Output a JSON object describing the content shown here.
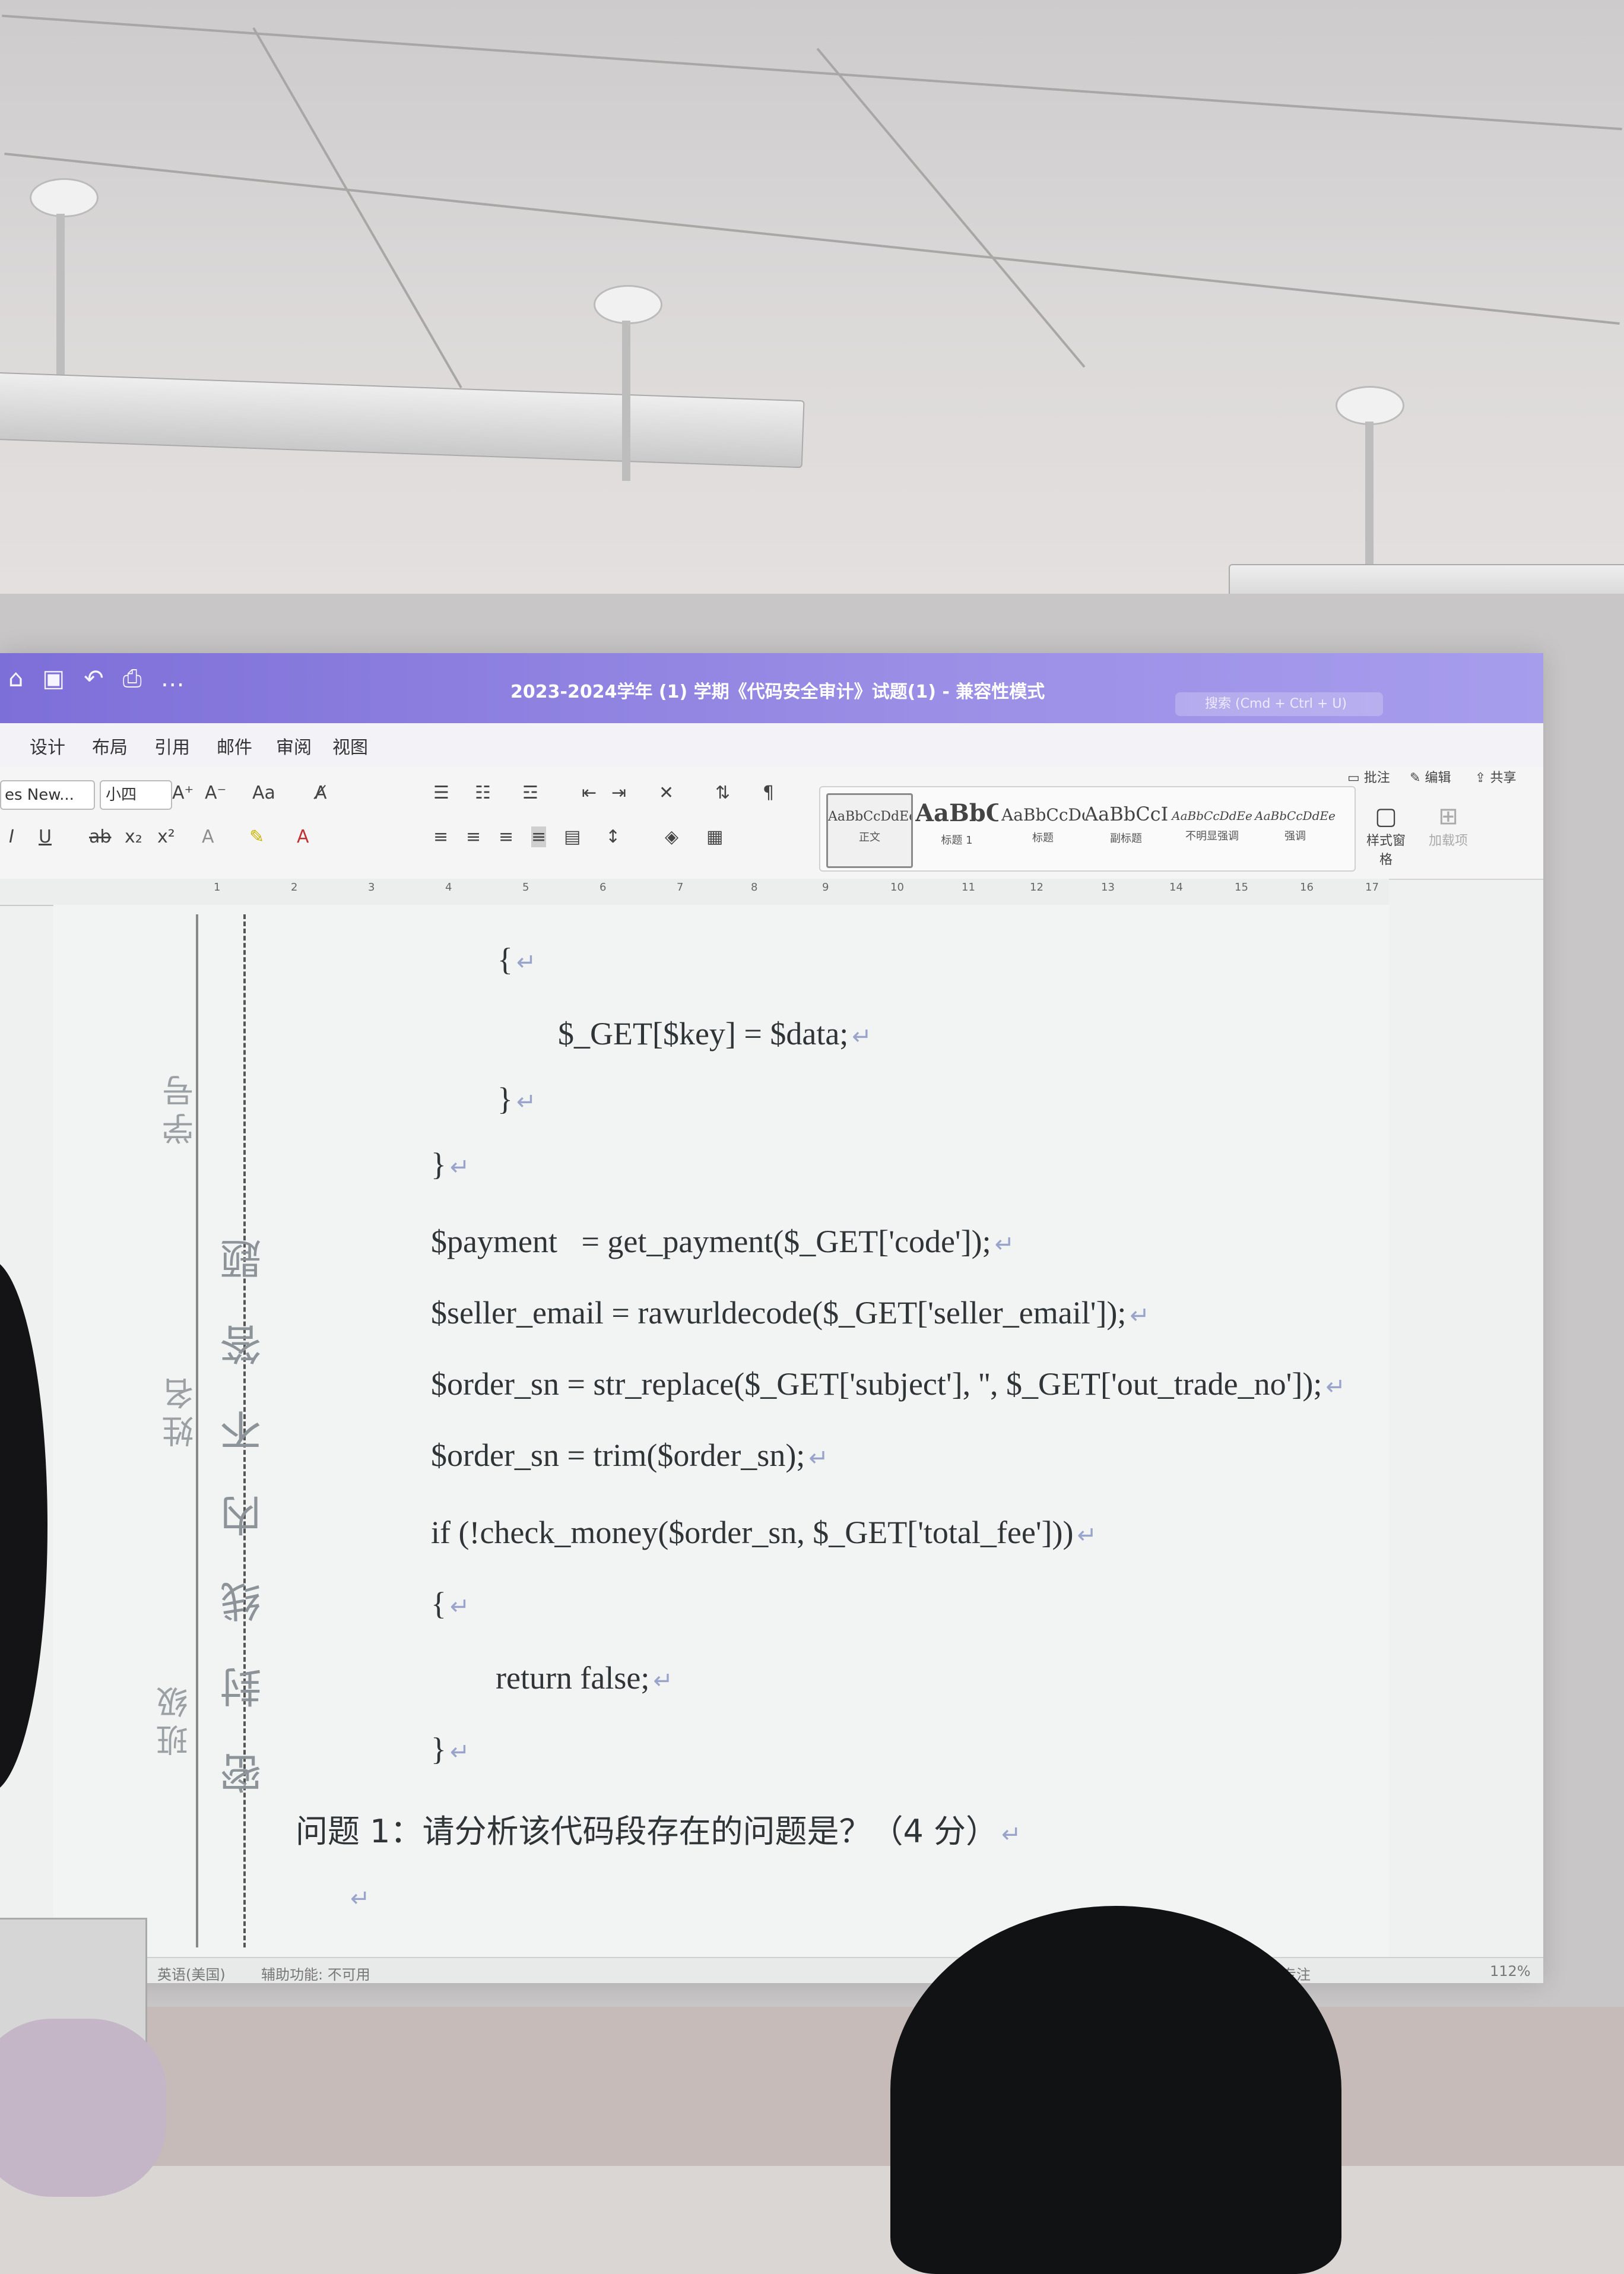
{
  "window": {
    "title": "2023-2024学年 (1) 学期《代码安全审计》试题(1) - 兼容性模式",
    "search_placeholder": "搜索 (Cmd + Ctrl + U)",
    "quick_access": [
      "home-icon",
      "save-icon",
      "undo-icon",
      "print-icon",
      "more-icon"
    ]
  },
  "tabs": [
    "设计",
    "布局",
    "引用",
    "邮件",
    "审阅",
    "视图"
  ],
  "toolbar": {
    "font_name": "es New...",
    "font_size": "小四",
    "change_case": "Aa",
    "styles": [
      {
        "sample": "AaBbCcDdEe",
        "name": "正文"
      },
      {
        "sample": "AaBbC",
        "name": "标题 1"
      },
      {
        "sample": "AaBbCcDd",
        "name": "标题"
      },
      {
        "sample": "AaBbCcI",
        "name": "副标题"
      },
      {
        "sample": "AaBbCcDdEe",
        "name": "不明显强调"
      },
      {
        "sample": "AaBbCcDdEe",
        "name": "强调"
      }
    ],
    "styles_pane": "样式窗格",
    "addins": "加载项",
    "comment": "批注",
    "edit": "编辑",
    "share": "共享"
  },
  "ruler": [
    "1",
    "2",
    "3",
    "4",
    "5",
    "6",
    "7",
    "8",
    "9",
    "10",
    "11",
    "12",
    "13",
    "14",
    "15",
    "16",
    "17"
  ],
  "margin": {
    "student_id": "学号",
    "name": "姓名",
    "class": "班级",
    "seal_text": "密 封 线 内 不 答 题"
  },
  "code_lines": [
    "{",
    "$_GET[$key] = $data;",
    "}",
    "}",
    "$payment   = get_payment($_GET['code']);",
    "$seller_email = rawurldecode($_GET['seller_email']);",
    "$order_sn = str_replace($_GET['subject'], '', $_GET['out_trade_no']);",
    "$order_sn = trim($order_sn);",
    "if (!check_money($order_sn, $_GET['total_fee']))",
    "{",
    "return false;",
    "}"
  ],
  "question": "问题 1：请分析该代码段存在的问题是？（4 分）",
  "paragraph_mark": "↵",
  "status": {
    "language": "英语(美国)",
    "accessibility": "辅助功能: 不可用",
    "focus": "专注",
    "zoom": "112%"
  }
}
